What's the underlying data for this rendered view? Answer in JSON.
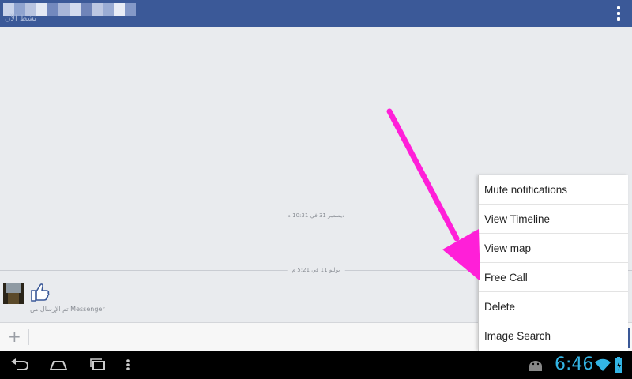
{
  "header": {
    "status": "نشط الآن",
    "name_colors": [
      "#c9d3ea",
      "#8fa3cf",
      "#b8c4e0",
      "#e4e9f4",
      "#7389be",
      "#a8b6d8",
      "#d3dbee",
      "#6f84b9",
      "#bcc7e2",
      "#9aacd4",
      "#e9edf6",
      "#8499c8"
    ]
  },
  "conversation": {
    "dividers": [
      {
        "label": "ديسمبر 31 في 10:31 م"
      },
      {
        "label": "يوليو 11 في 5:21 م"
      }
    ],
    "sent_from": "تم الإرسال من Messenger"
  },
  "composer": {
    "add_icon": "plus-icon",
    "placeholder": ""
  },
  "menu": {
    "items": [
      "Mute notifications",
      "View Timeline",
      "View map",
      "Free Call",
      "Delete",
      "Image Search"
    ]
  },
  "statusbar": {
    "time": "6:46",
    "icons": [
      "android-debug-icon",
      "wifi-icon",
      "battery-charging-icon"
    ]
  },
  "colors": {
    "header_bg": "#3b5998",
    "clock": "#33b5e5",
    "annotation_arrow": "#ff1fd8"
  }
}
